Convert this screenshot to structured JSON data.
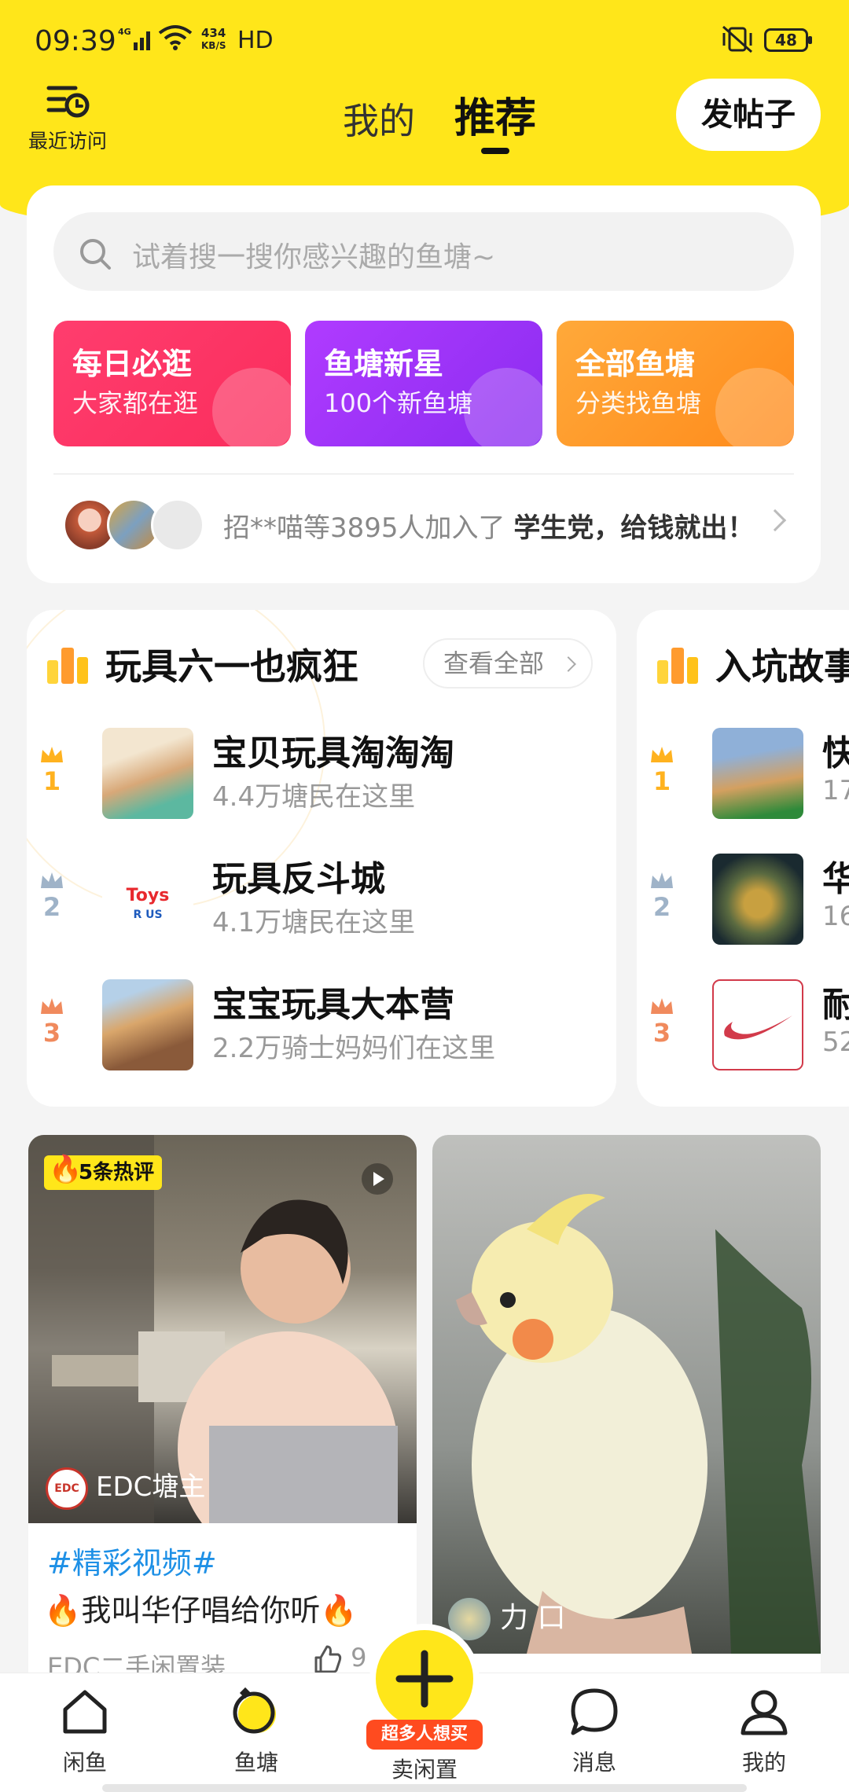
{
  "status_bar": {
    "time": "09:39",
    "network": "4G",
    "speed_value": "434",
    "speed_unit": "KB/S",
    "hd": "HD",
    "battery": "48"
  },
  "header": {
    "recent_label": "最近访问",
    "tabs": [
      "我的",
      "推荐"
    ],
    "active_tab": "推荐",
    "post_button": "发帖子"
  },
  "search": {
    "placeholder": "试着搜一搜你感兴趣的鱼塘~"
  },
  "tiles": [
    {
      "title": "每日必逛",
      "subtitle": "大家都在逛"
    },
    {
      "title": "鱼塘新星",
      "subtitle": "100个新鱼塘"
    },
    {
      "title": "全部鱼塘",
      "subtitle": "分类找鱼塘"
    }
  ],
  "joined": {
    "text": "招**喵等3895人加入了",
    "pond": "学生党，给钱就出！"
  },
  "ranking": {
    "title": "玩具六一也疯狂",
    "view_all": "查看全部",
    "items": [
      {
        "rank": "1",
        "name": "宝贝玩具淘淘淘",
        "sub": "4.4万塘民在这里"
      },
      {
        "rank": "2",
        "name": "玩具反斗城",
        "sub": "4.1万塘民在这里"
      },
      {
        "rank": "3",
        "name": "宝宝玩具大本营",
        "sub": "2.2万骑士妈妈们在这里"
      }
    ]
  },
  "ranking2": {
    "title": "入坑故事",
    "items": [
      {
        "rank": "1",
        "name": "快",
        "sub": "17"
      },
      {
        "rank": "2",
        "name": "华",
        "sub": "16"
      },
      {
        "rank": "3",
        "name": "耐",
        "sub": "52"
      }
    ]
  },
  "feed": [
    {
      "badge": "5条热评",
      "author": "EDC塘主",
      "author_logo": "EDC",
      "topic": "#精彩视频#",
      "text": "我叫华仔唱给你听",
      "pond": "EDC二手闲置装",
      "likes": "9"
    },
    {
      "author": "力 口"
    }
  ],
  "bottom_nav": {
    "items": [
      "闲鱼",
      "鱼塘",
      "卖闲置",
      "消息",
      "我的"
    ],
    "sell_tag": "超多人想买"
  },
  "colors": {
    "brand_yellow": "#ffe61a",
    "tile_pink": "#fa2d5c",
    "tile_purple": "#8a2cf0",
    "tile_orange": "#ff8a1a",
    "topic_blue": "#1e90e6"
  }
}
